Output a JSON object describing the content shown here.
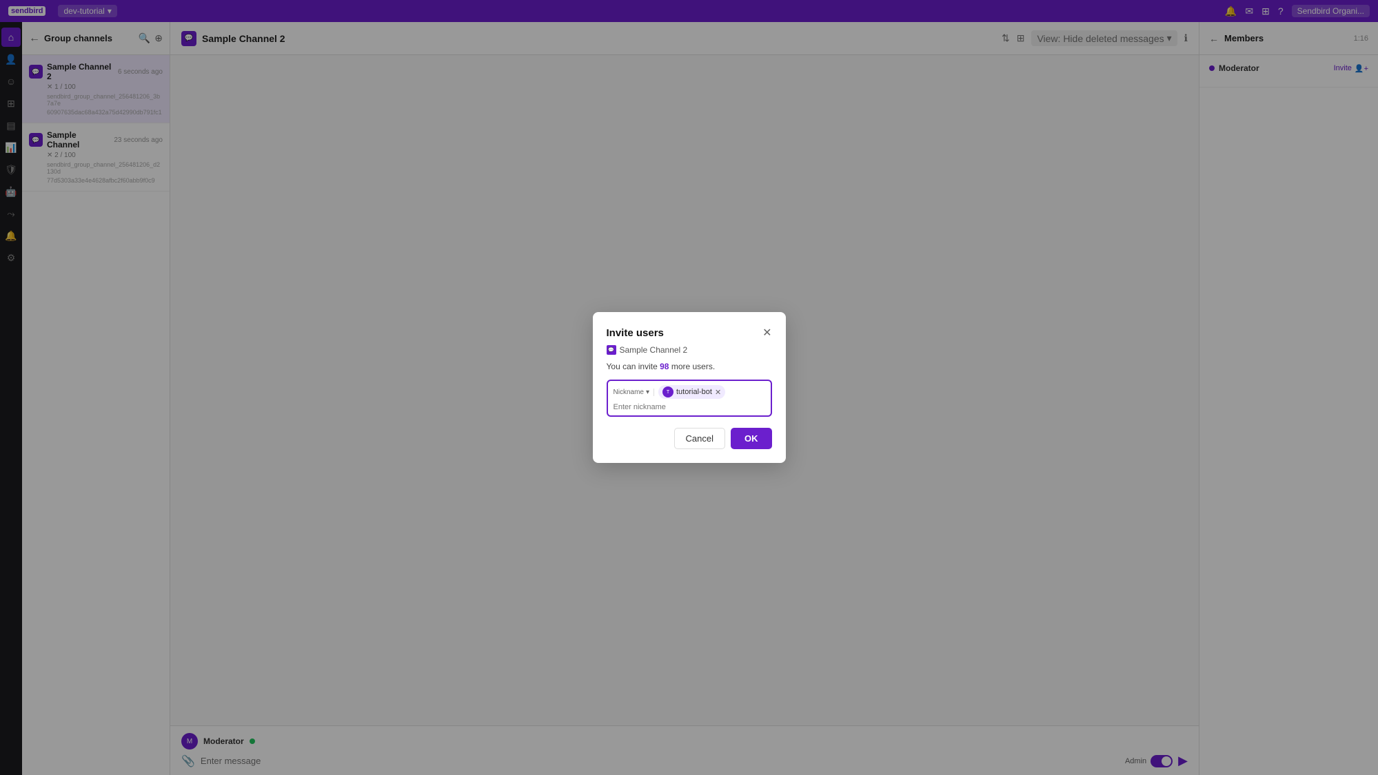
{
  "topbar": {
    "logo_text": "sendbird",
    "org_name": "dev-tutorial",
    "org_chevron": "▾",
    "icons": [
      "🔔",
      "✉",
      "⊞",
      "?"
    ],
    "user_label": "Sendbird Organi..."
  },
  "sidebar": {
    "icons": [
      {
        "name": "home-icon",
        "symbol": "⌂",
        "active": true
      },
      {
        "name": "users-icon",
        "symbol": "👤",
        "active": false
      },
      {
        "name": "emoji-icon",
        "symbol": "☺",
        "active": false
      },
      {
        "name": "channels-icon",
        "symbol": "⊞",
        "active": false
      },
      {
        "name": "messages-icon",
        "symbol": "▤",
        "active": false
      },
      {
        "name": "analytics-icon",
        "symbol": "📊",
        "active": false
      },
      {
        "name": "moderation-icon",
        "symbol": "🛡",
        "active": false
      },
      {
        "name": "bots-icon",
        "symbol": "🤖",
        "active": false
      },
      {
        "name": "flows-icon",
        "symbol": "⤳",
        "active": false
      },
      {
        "name": "notifications-icon",
        "symbol": "🔔",
        "active": false
      },
      {
        "name": "settings-icon",
        "symbol": "⚙",
        "active": false
      },
      {
        "name": "more-icon",
        "symbol": "⋯",
        "active": false
      }
    ]
  },
  "channel_panel": {
    "title": "Group channels",
    "channels": [
      {
        "name": "Sample Channel 2",
        "time": "6 seconds ago",
        "meta": "✕ 1 / 100",
        "url_line1": "sendbird_group_channel_256481206_3b7a7e",
        "url_line2": "60907635dac68a432a75d42990db791fc1",
        "active": true
      },
      {
        "name": "Sample Channel",
        "time": "23 seconds ago",
        "meta": "✕ 2 / 100",
        "url_line1": "sendbird_group_channel_256481206_d2130d",
        "url_line2": "77d5303a33e4e4628afbc2f60abb9f0c9",
        "active": false
      }
    ]
  },
  "chat_header": {
    "title": "Sample Channel 2",
    "view_label": "View: Hide deleted messages",
    "chevron": "▾"
  },
  "chat_input": {
    "sender_name": "Moderator",
    "placeholder": "Enter message",
    "admin_label": "Admin",
    "attach_icon": "📎",
    "send_icon": "▶"
  },
  "right_panel": {
    "title": "Members",
    "time_label": "1:16",
    "back_icon": "←",
    "moderator_label": "Moderator",
    "invite_label": "Invite",
    "invite_icon": "👤+"
  },
  "modal": {
    "title": "Invite users",
    "channel_name": "Sample Channel 2",
    "info_text_prefix": "You can invite ",
    "invite_count": "98",
    "info_text_suffix": " more users.",
    "filter_label": "Nickname",
    "filter_chevron": "▾",
    "user_tag_name": "tutorial-bot",
    "user_tag_remove": "✕",
    "input_placeholder": "Enter nickname",
    "cancel_label": "Cancel",
    "ok_label": "OK"
  }
}
